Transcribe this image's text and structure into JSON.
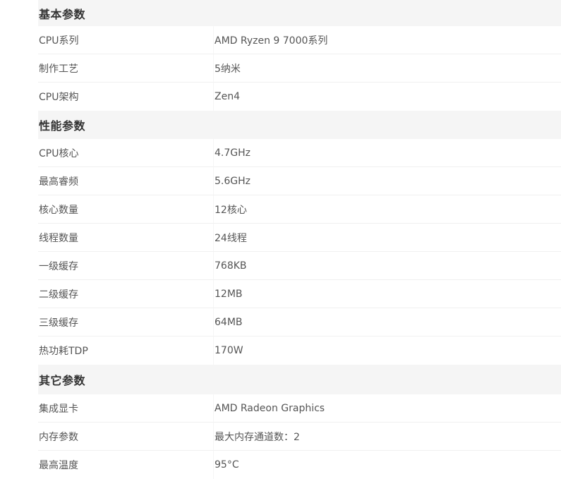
{
  "sections": [
    {
      "title": "基本参数",
      "rows": [
        {
          "label": "CPU系列",
          "value": "AMD Ryzen 9 7000系列"
        },
        {
          "label": "制作工艺",
          "value": "5纳米"
        },
        {
          "label": "CPU架构",
          "value": "Zen4"
        }
      ]
    },
    {
      "title": "性能参数",
      "rows": [
        {
          "label": "CPU核心",
          "value": "4.7GHz"
        },
        {
          "label": "最高睿频",
          "value": "5.6GHz"
        },
        {
          "label": "核心数量",
          "value": "12核心"
        },
        {
          "label": "线程数量",
          "value": "24线程"
        },
        {
          "label": "一级缓存",
          "value": "768KB"
        },
        {
          "label": "二级缓存",
          "value": "12MB"
        },
        {
          "label": "三级缓存",
          "value": "64MB"
        },
        {
          "label": "热功耗TDP",
          "value": "170W"
        }
      ]
    },
    {
      "title": "其它参数",
      "rows": [
        {
          "label": "集成显卡",
          "value": "AMD Radeon Graphics"
        },
        {
          "label": "内存参数",
          "value": "最大内存通道数：2"
        },
        {
          "label": "最高温度",
          "value": "95°C"
        }
      ]
    }
  ]
}
